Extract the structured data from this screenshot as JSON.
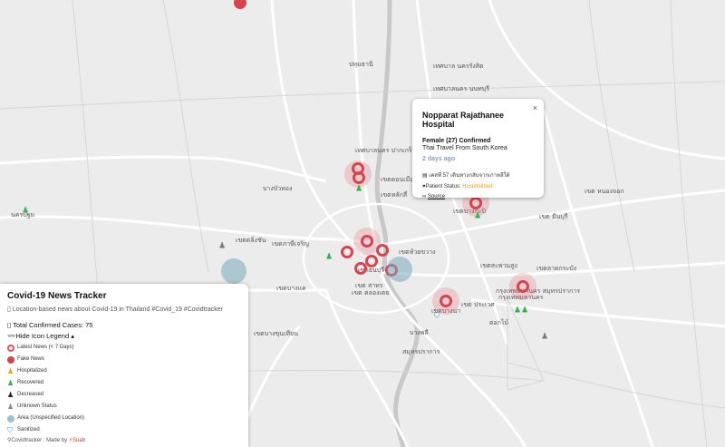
{
  "map": {
    "labels": [
      {
        "id": "place-pakkret",
        "text": "เทศบาลนคร ปากเกร็ด"
      },
      {
        "id": "place-nonthaburi",
        "text": "เทศบาลนคร นนทบุรี"
      },
      {
        "id": "place-rangsit",
        "text": "เทศบาล นครรังสิต"
      },
      {
        "id": "place-pathumthani",
        "text": "ปทุมธานี"
      },
      {
        "id": "place-bangkapi",
        "text": "เขตบางกะปิ"
      },
      {
        "id": "place-samutprakan",
        "text": "กรุงเทพมหานคร สมุทรปราการ"
      },
      {
        "id": "place-bangbuathong",
        "text": "บางบัวทอง"
      },
      {
        "id": "place-nakhonpathom",
        "text": "นครปฐม"
      },
      {
        "id": "place-phasicharoen",
        "text": "เขตภาษีเจริญ"
      },
      {
        "id": "place-khlongtoei",
        "text": "เขต คลองเตย"
      },
      {
        "id": "place-praves",
        "text": "เขต ประเวศ"
      },
      {
        "id": "place-bangkhen",
        "text": "เขตหลักสี่"
      },
      {
        "id": "place-donmueang",
        "text": "เขตดอนเมือง"
      },
      {
        "id": "place-latkrabang",
        "text": "เขตลาดกระบัง"
      },
      {
        "id": "place-minburi",
        "text": "เขต มีนบุรี"
      },
      {
        "id": "place-nongchok",
        "text": "เขต หนองจอก"
      },
      {
        "id": "place-bangkhuntien",
        "text": "เขตบางขุนเทียน"
      },
      {
        "id": "place-samutprakan2",
        "text": "สมุทรปราการ"
      },
      {
        "id": "place-bangpli",
        "text": "บางพลี"
      },
      {
        "id": "place-bangphli2",
        "text": "ดอกไม้"
      },
      {
        "id": "place-thonburi",
        "text": "เขตธนบุรี"
      },
      {
        "id": "place-bangkhae",
        "text": "เขตบางแค"
      },
      {
        "id": "place-talingchan",
        "text": "เขตตลิ่งชัน"
      },
      {
        "id": "place-sathon",
        "text": "เขต สาทร"
      },
      {
        "id": "place-bangna",
        "text": "เขตบางนา"
      },
      {
        "id": "place-sapansung",
        "text": "เขตสะพานสูง"
      },
      {
        "id": "place-huaikhwang",
        "text": "เขตห้วยขวาง"
      },
      {
        "id": "place-bangkok",
        "text": "กรุงเทพมหานคร"
      }
    ]
  },
  "popup": {
    "close_label": "×",
    "title": "Nopparat Rajathanee Hospital",
    "gender_line": "Female (27) Confirmed",
    "travel_line": "Thai Travel From South Korea",
    "ago": "2 days ago",
    "case_icon": "clipboard-icon",
    "case_line": "เคสที่ 57 เดินทางกลับจากเกาหลีใต้",
    "status_label": "Patient Status:",
    "status_value": "Hospitalized",
    "source_label": "Source"
  },
  "panel": {
    "title": "Covid-19 News Tracker",
    "description": "Location-based news about Covid-19 in Thailand #Covid_19 #Covidtracker",
    "total_label": "Total Confirmed Cases: 75",
    "legend_toggle": "Hide Icon Legend",
    "legend": [
      {
        "icon": "latest-news-icon",
        "label": "Latest News (< 7 Days)",
        "color": "#e2505a"
      },
      {
        "icon": "fake-news-icon",
        "label": "Fake News",
        "color": "#d4454d"
      },
      {
        "icon": "hospitalized-icon",
        "label": "Hospitalized",
        "color": "#f0a020"
      },
      {
        "icon": "recovered-icon",
        "label": "Recovered",
        "color": "#2bb24c"
      },
      {
        "icon": "decreased-icon",
        "label": "Decreased",
        "color": "#222222"
      },
      {
        "icon": "unknown-status-icon",
        "label": "Unknown Status",
        "color": "#888888"
      },
      {
        "icon": "area-icon",
        "label": "Area (Unspecified Location)",
        "color": "#78aabe"
      },
      {
        "icon": "sanitized-icon",
        "label": "Sanitized",
        "color": "#3aa0d8"
      }
    ],
    "footer_prefix": "Covidtracker : Made by",
    "footer_by": "Suab"
  }
}
